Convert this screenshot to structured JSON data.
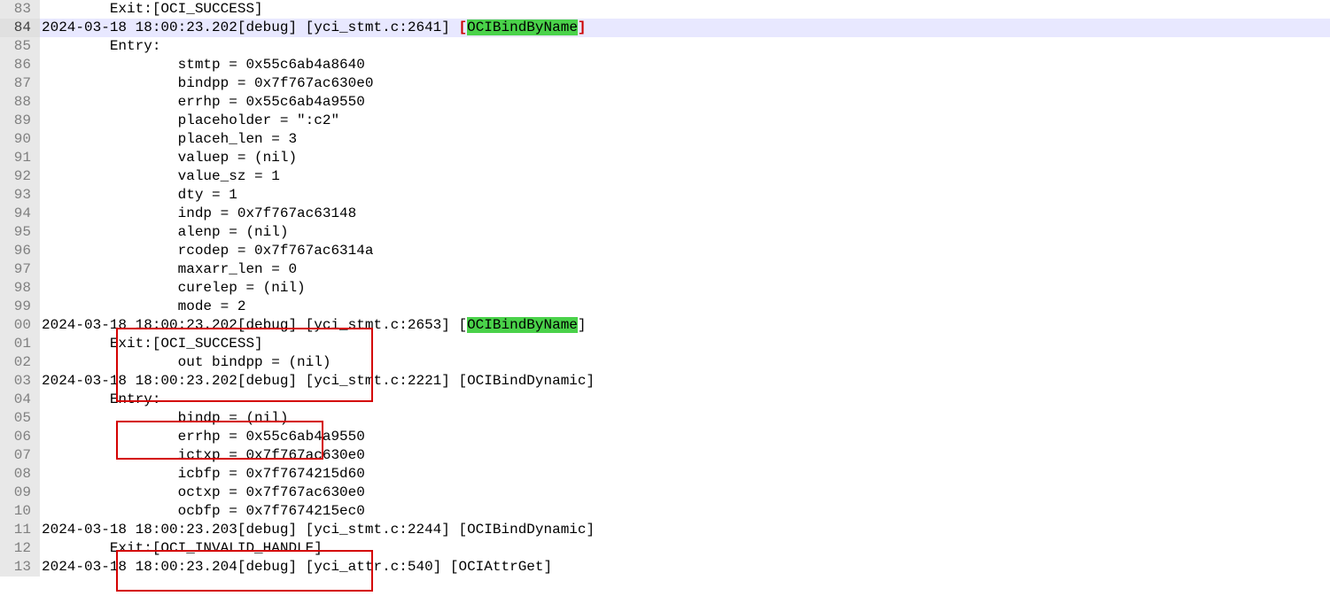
{
  "startLine": 83,
  "lines": [
    {
      "type": "plain",
      "text": "        Exit:[OCI_SUCCESS]"
    },
    {
      "type": "hdr",
      "active": true,
      "prefix": "2024-03-18 18:00:23.202[debug] [yci_stmt.c:2641] ",
      "br1": "[",
      "fn": "OCIBindByName",
      "br2": "]",
      "bracketRed": true
    },
    {
      "type": "plain",
      "text": "        Entry:"
    },
    {
      "type": "plain",
      "text": "                stmtp = 0x55c6ab4a8640"
    },
    {
      "type": "plain",
      "text": "                bindpp = 0x7f767ac630e0"
    },
    {
      "type": "plain",
      "text": "                errhp = 0x55c6ab4a9550"
    },
    {
      "type": "plain",
      "text": "                placeholder = \":c2\""
    },
    {
      "type": "plain",
      "text": "                placeh_len = 3"
    },
    {
      "type": "plain",
      "text": "                valuep = (nil)"
    },
    {
      "type": "plain",
      "text": "                value_sz = 1"
    },
    {
      "type": "plain",
      "text": "                dty = 1"
    },
    {
      "type": "plain",
      "text": "                indp = 0x7f767ac63148"
    },
    {
      "type": "plain",
      "text": "                alenp = (nil)"
    },
    {
      "type": "plain",
      "text": "                rcodep = 0x7f767ac6314a"
    },
    {
      "type": "plain",
      "text": "                maxarr_len = 0"
    },
    {
      "type": "plain",
      "text": "                curelep = (nil)"
    },
    {
      "type": "plain",
      "text": "                mode = 2"
    },
    {
      "type": "hdr",
      "active": false,
      "prefix": "2024-03-18 18:00:23.202[debug] [yci_stmt.c:2653] [",
      "br1": "",
      "fn": "OCIBindByName",
      "br2": "]",
      "bracketRed": false
    },
    {
      "type": "plain",
      "text": "        Exit:[OCI_SUCCESS]"
    },
    {
      "type": "plain",
      "text": "                out bindpp = (nil)"
    },
    {
      "type": "plain",
      "text": "2024-03-18 18:00:23.202[debug] [yci_stmt.c:2221] [OCIBindDynamic]"
    },
    {
      "type": "plain",
      "text": "        Entry:"
    },
    {
      "type": "plain",
      "text": "                bindp = (nil)"
    },
    {
      "type": "plain",
      "text": "                errhp = 0x55c6ab4a9550"
    },
    {
      "type": "plain",
      "text": "                ictxp = 0x7f767ac630e0"
    },
    {
      "type": "plain",
      "text": "                icbfp = 0x7f7674215d60"
    },
    {
      "type": "plain",
      "text": "                octxp = 0x7f767ac630e0"
    },
    {
      "type": "plain",
      "text": "                ocbfp = 0x7f7674215ec0"
    },
    {
      "type": "plain",
      "text": "2024-03-18 18:00:23.203[debug] [yci_stmt.c:2244] [OCIBindDynamic]"
    },
    {
      "type": "plain",
      "text": "        Exit:[OCI_INVALID_HANDLE]"
    },
    {
      "type": "plain",
      "text": "2024-03-18 18:00:23.204[debug] [yci_attr.c:540] [OCIAttrGet]"
    }
  ],
  "annotations": [
    "box-a",
    "box-b",
    "box-c"
  ]
}
